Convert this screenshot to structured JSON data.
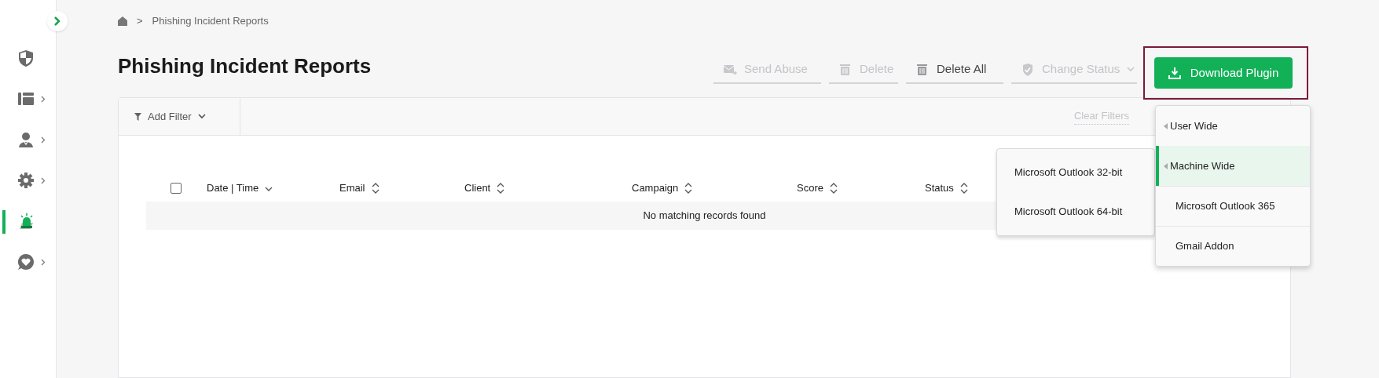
{
  "sidebar": {
    "items": [
      {
        "kind": "shield",
        "has_chevron": false,
        "selected": false
      },
      {
        "kind": "layout",
        "has_chevron": true,
        "selected": false
      },
      {
        "kind": "person",
        "has_chevron": true,
        "selected": false
      },
      {
        "kind": "gear",
        "has_chevron": true,
        "selected": false
      },
      {
        "kind": "alarm",
        "has_chevron": false,
        "selected": true
      },
      {
        "kind": "heart",
        "has_chevron": true,
        "selected": false
      }
    ]
  },
  "breadcrumb": {
    "separator": ">",
    "current": "Phishing Incident Reports"
  },
  "title": "Phishing Incident Reports",
  "actions": [
    {
      "kind": "mail",
      "label": "Send Abuse",
      "disabled": true
    },
    {
      "kind": "trash",
      "label": "Delete",
      "disabled": true
    },
    {
      "kind": "trash",
      "label": "Delete All",
      "disabled": false
    },
    {
      "kind": "status",
      "label": "Change Status",
      "disabled": true
    }
  ],
  "download_button": {
    "label": "Download Plugin"
  },
  "filter_bar": {
    "add_filter": "Add Filter",
    "clear_filters": "Clear Filters"
  },
  "table": {
    "columns": [
      {
        "label": "Date | Time",
        "sorted": true
      },
      {
        "label": "Email",
        "sorted": false
      },
      {
        "label": "Client",
        "sorted": false
      },
      {
        "label": "Campaign",
        "sorted": false
      },
      {
        "label": "Score",
        "sorted": false
      },
      {
        "label": "Status",
        "sorted": false
      }
    ],
    "select_all": {
      "checked": false
    },
    "empty_message": "No matching records found"
  },
  "download_menu": {
    "items": [
      {
        "label": "User Wide",
        "has_submenu": true,
        "selected": false
      },
      {
        "label": "Machine Wide",
        "has_submenu": true,
        "selected": true
      },
      {
        "label": "Microsoft Outlook 365",
        "has_submenu": false,
        "selected": false
      },
      {
        "label": "Gmail Addon",
        "has_submenu": false,
        "selected": false
      }
    ]
  },
  "submenu": {
    "items": [
      "Microsoft Outlook 32-bit",
      "Microsoft Outlook 64-bit"
    ]
  }
}
